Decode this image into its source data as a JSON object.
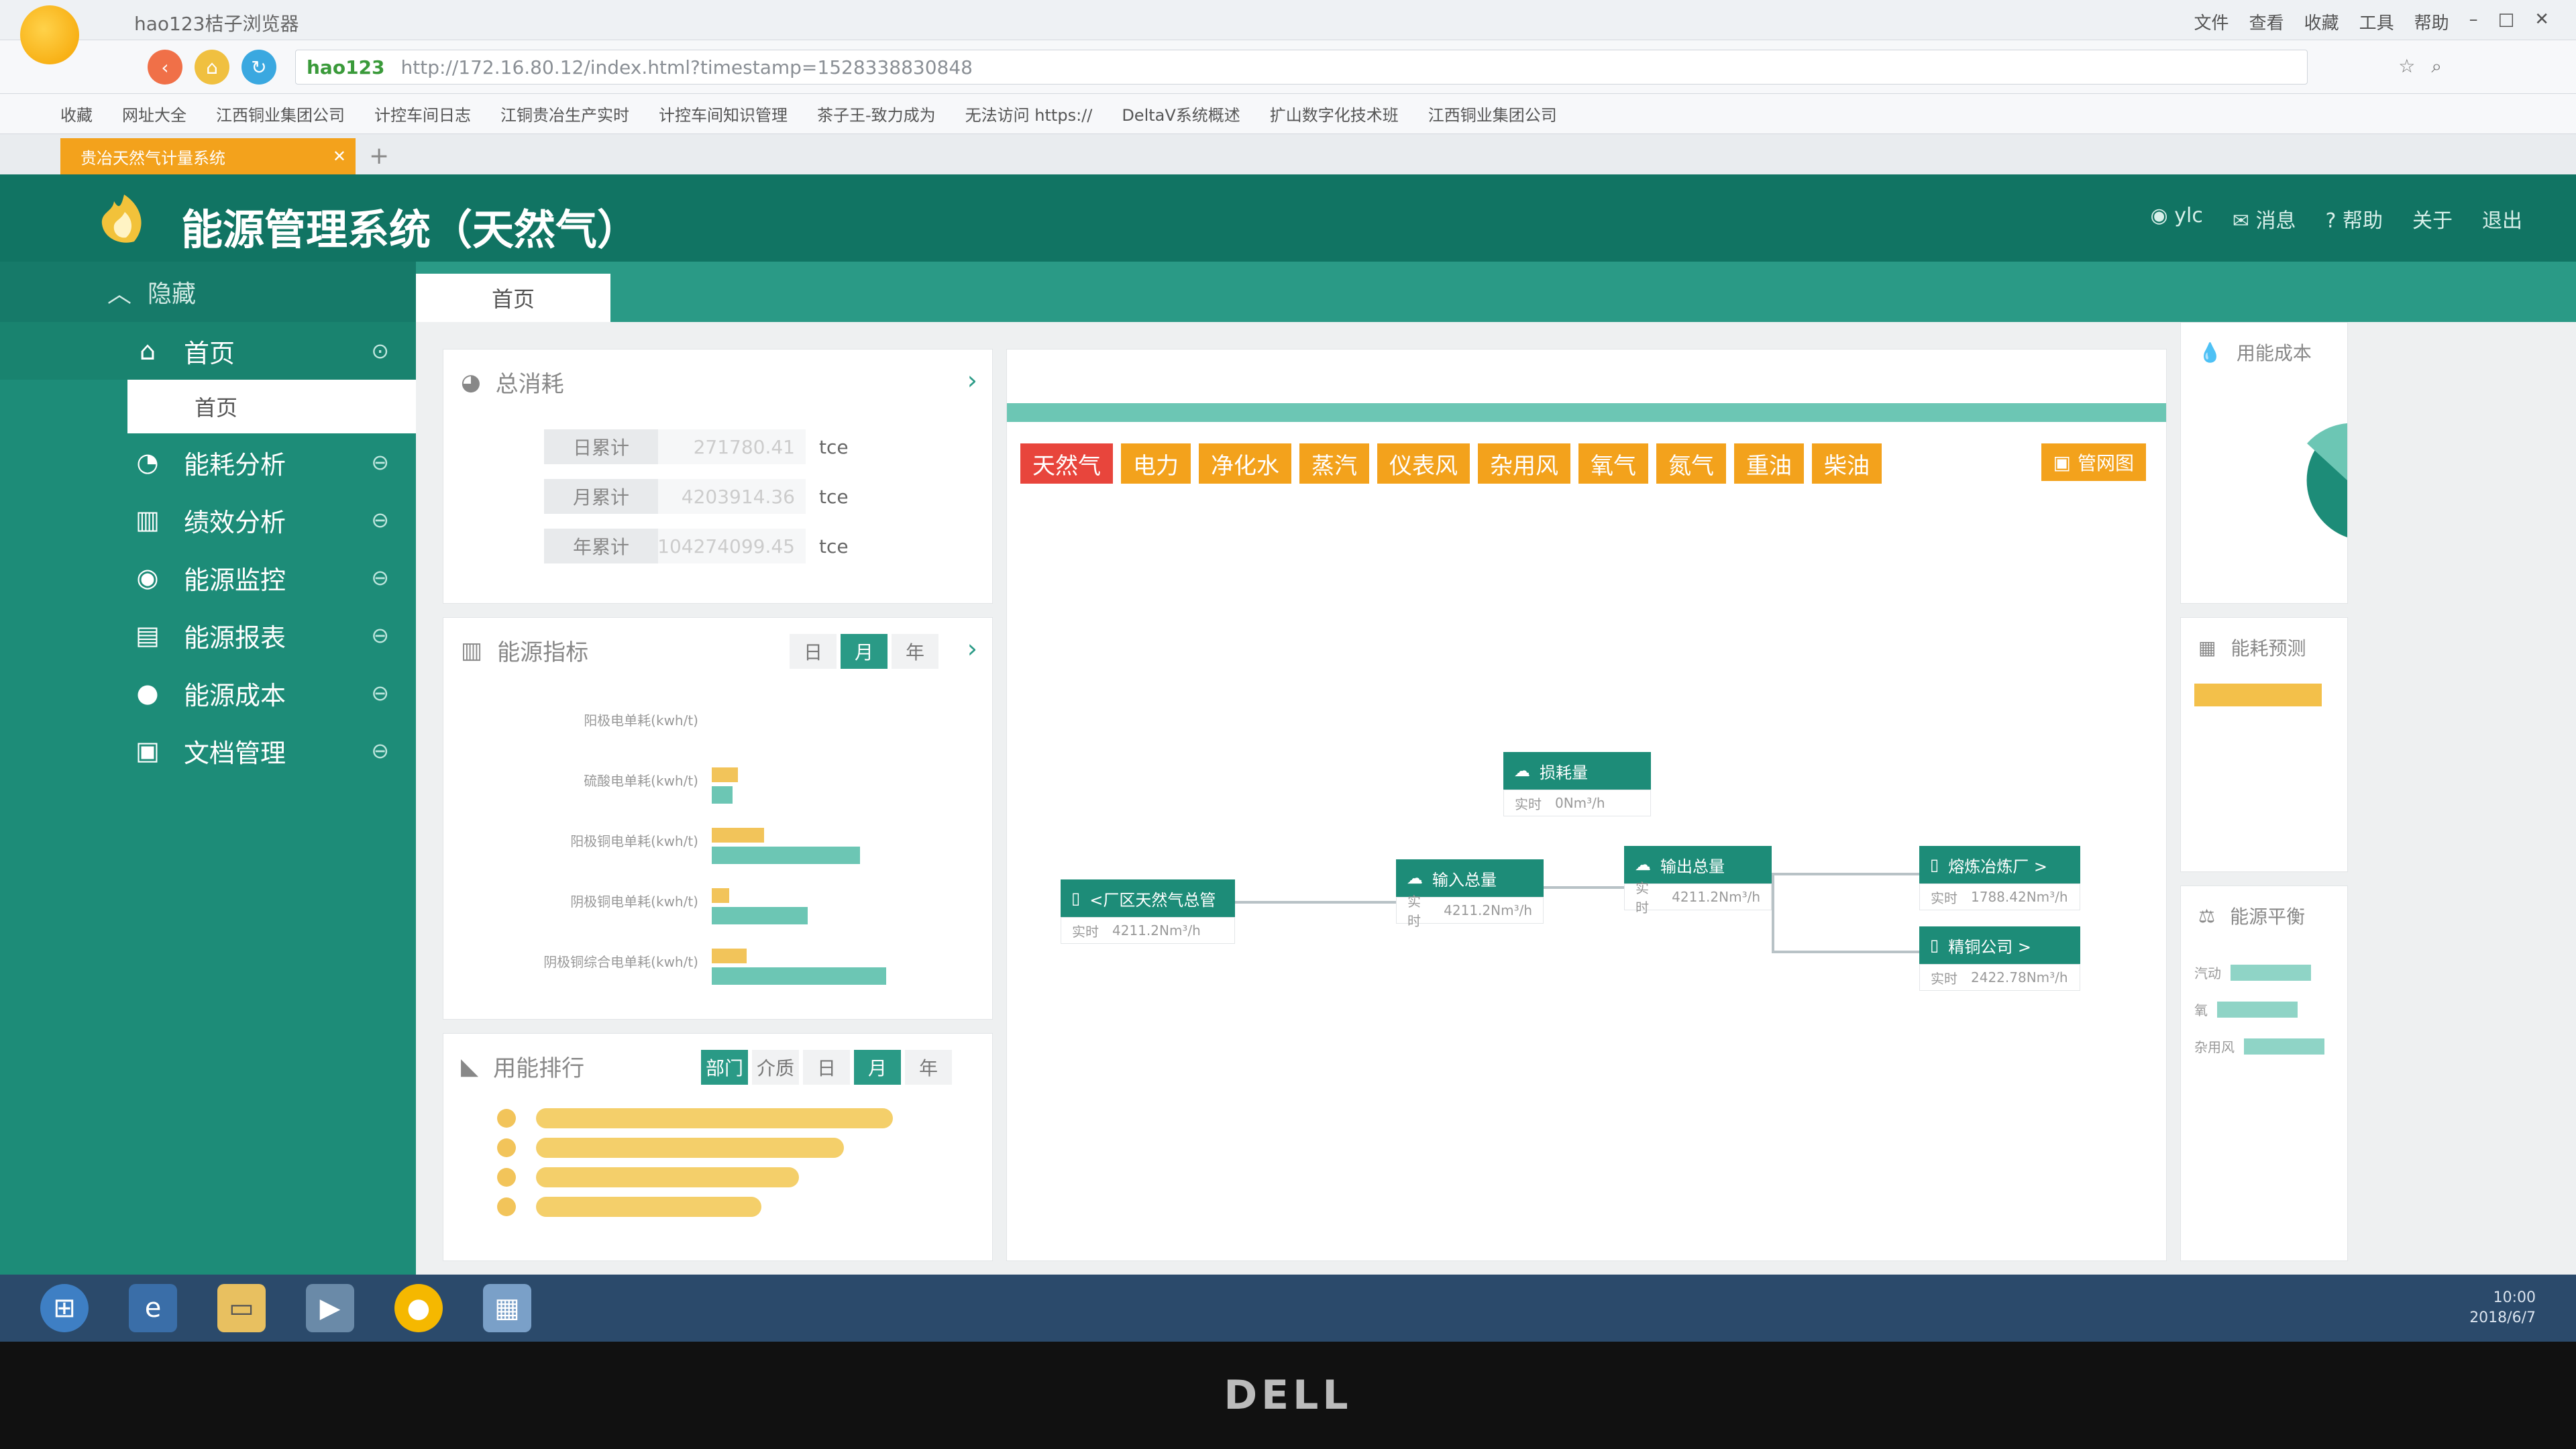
{
  "browser": {
    "name": "hao123桔子浏览器",
    "menu": [
      "文件",
      "查看",
      "收藏",
      "工具",
      "帮助"
    ],
    "url_tag": "hao123",
    "url": "http://172.16.80.12/index.html?timestamp=1528338830848",
    "bookmarks": [
      "收藏",
      "网址大全",
      "江西铜业集团公司",
      "计控车间日志",
      "江铜贵冶生产实时",
      "计控车间知识管理",
      "茶子王-致力成为",
      "无法访问 https://",
      "DeltaV系统概述",
      "扩山数字化技术班",
      "江西铜业集团公司"
    ],
    "tab_title": "贵冶天然气计量系统"
  },
  "app": {
    "title": "能源管理系统（天然气）",
    "header_links": [
      "ylc",
      "消息",
      "帮助",
      "关于",
      "退出"
    ],
    "colors": {
      "header": "#117463",
      "sidebar": "#1d8c78",
      "accent": "#f3a21c",
      "active_tab": "#e8453c"
    }
  },
  "sidebar": {
    "collapse_label": "隐藏",
    "home_label": "首页",
    "home_sub": "首页",
    "items": [
      {
        "label": "能耗分析",
        "icon": "pie-chart-icon"
      },
      {
        "label": "绩效分析",
        "icon": "bar-chart-icon"
      },
      {
        "label": "能源监控",
        "icon": "eye-icon"
      },
      {
        "label": "能源报表",
        "icon": "report-icon"
      },
      {
        "label": "能源成本",
        "icon": "cost-icon"
      },
      {
        "label": "文档管理",
        "icon": "document-icon"
      }
    ]
  },
  "content": {
    "tab_home": "首页",
    "total": {
      "title": "总消耗",
      "rows": [
        {
          "label": "日累计",
          "value": "271780.41",
          "unit": "tce"
        },
        {
          "label": "月累计",
          "value": "4203914.36",
          "unit": "tce"
        },
        {
          "label": "年累计",
          "value": "104274099.45",
          "unit": "tce"
        }
      ]
    },
    "indicator": {
      "title": "能源指标",
      "periods": [
        "日",
        "月",
        "年"
      ],
      "selected_period": "月",
      "bars": [
        {
          "label": "阳极电单耗(kwh/t)",
          "a": 0.0,
          "b": 0.0
        },
        {
          "label": "硫酸电单耗(kwh/t)",
          "a": 0.15,
          "b": 0.12
        },
        {
          "label": "阳极铜电单耗(kwh/t)",
          "a": 0.3,
          "b": 0.85
        },
        {
          "label": "阴极铜电单耗(kwh/t)",
          "a": 0.1,
          "b": 0.55
        },
        {
          "label": "阴极铜综合电单耗(kwh/t)",
          "a": 0.2,
          "b": 1.0
        }
      ]
    },
    "ranking": {
      "title": "用能排行",
      "groups": [
        "部门",
        "介质"
      ],
      "selected_group": "部门",
      "periods": [
        "日",
        "月",
        "年"
      ],
      "selected_period": "月",
      "bars": [
        0.95,
        0.82,
        0.7,
        0.6
      ]
    },
    "flow": {
      "energy_tabs": [
        "天然气",
        "电力",
        "净化水",
        "蒸汽",
        "仪表风",
        "杂用风",
        "氧气",
        "氮气",
        "重油",
        "柴油"
      ],
      "selected_tab": "天然气",
      "full_view_label": "管网图",
      "nodes": {
        "source": {
          "label": "<厂区天然气总管",
          "realtime_label": "实时",
          "value": "4211.2Nm³/h"
        },
        "input": {
          "label": "输入总量",
          "realtime_label": "实时",
          "value": "4211.2Nm³/h"
        },
        "loss": {
          "label": "损耗量",
          "realtime_label": "实时",
          "value": "0Nm³/h"
        },
        "output": {
          "label": "输出总量",
          "realtime_label": "实时",
          "value": "4211.2Nm³/h"
        },
        "smelter": {
          "label": "熔炼冶炼厂 >",
          "realtime_label": "实时",
          "value": "1788.42Nm³/h"
        },
        "other": {
          "label": "精铜公司 >",
          "realtime_label": "实时",
          "value": "2422.78Nm³/h"
        }
      }
    },
    "right": {
      "cost_title": "用能成本",
      "forecast_title": "能耗预测",
      "balance_title": "能源平衡",
      "balance_rows": [
        "汽动",
        "氧",
        "杂用风"
      ]
    }
  },
  "taskbar": {
    "time": "10:00",
    "date": "2018/6/7"
  },
  "monitor": {
    "brand": "DELL"
  }
}
